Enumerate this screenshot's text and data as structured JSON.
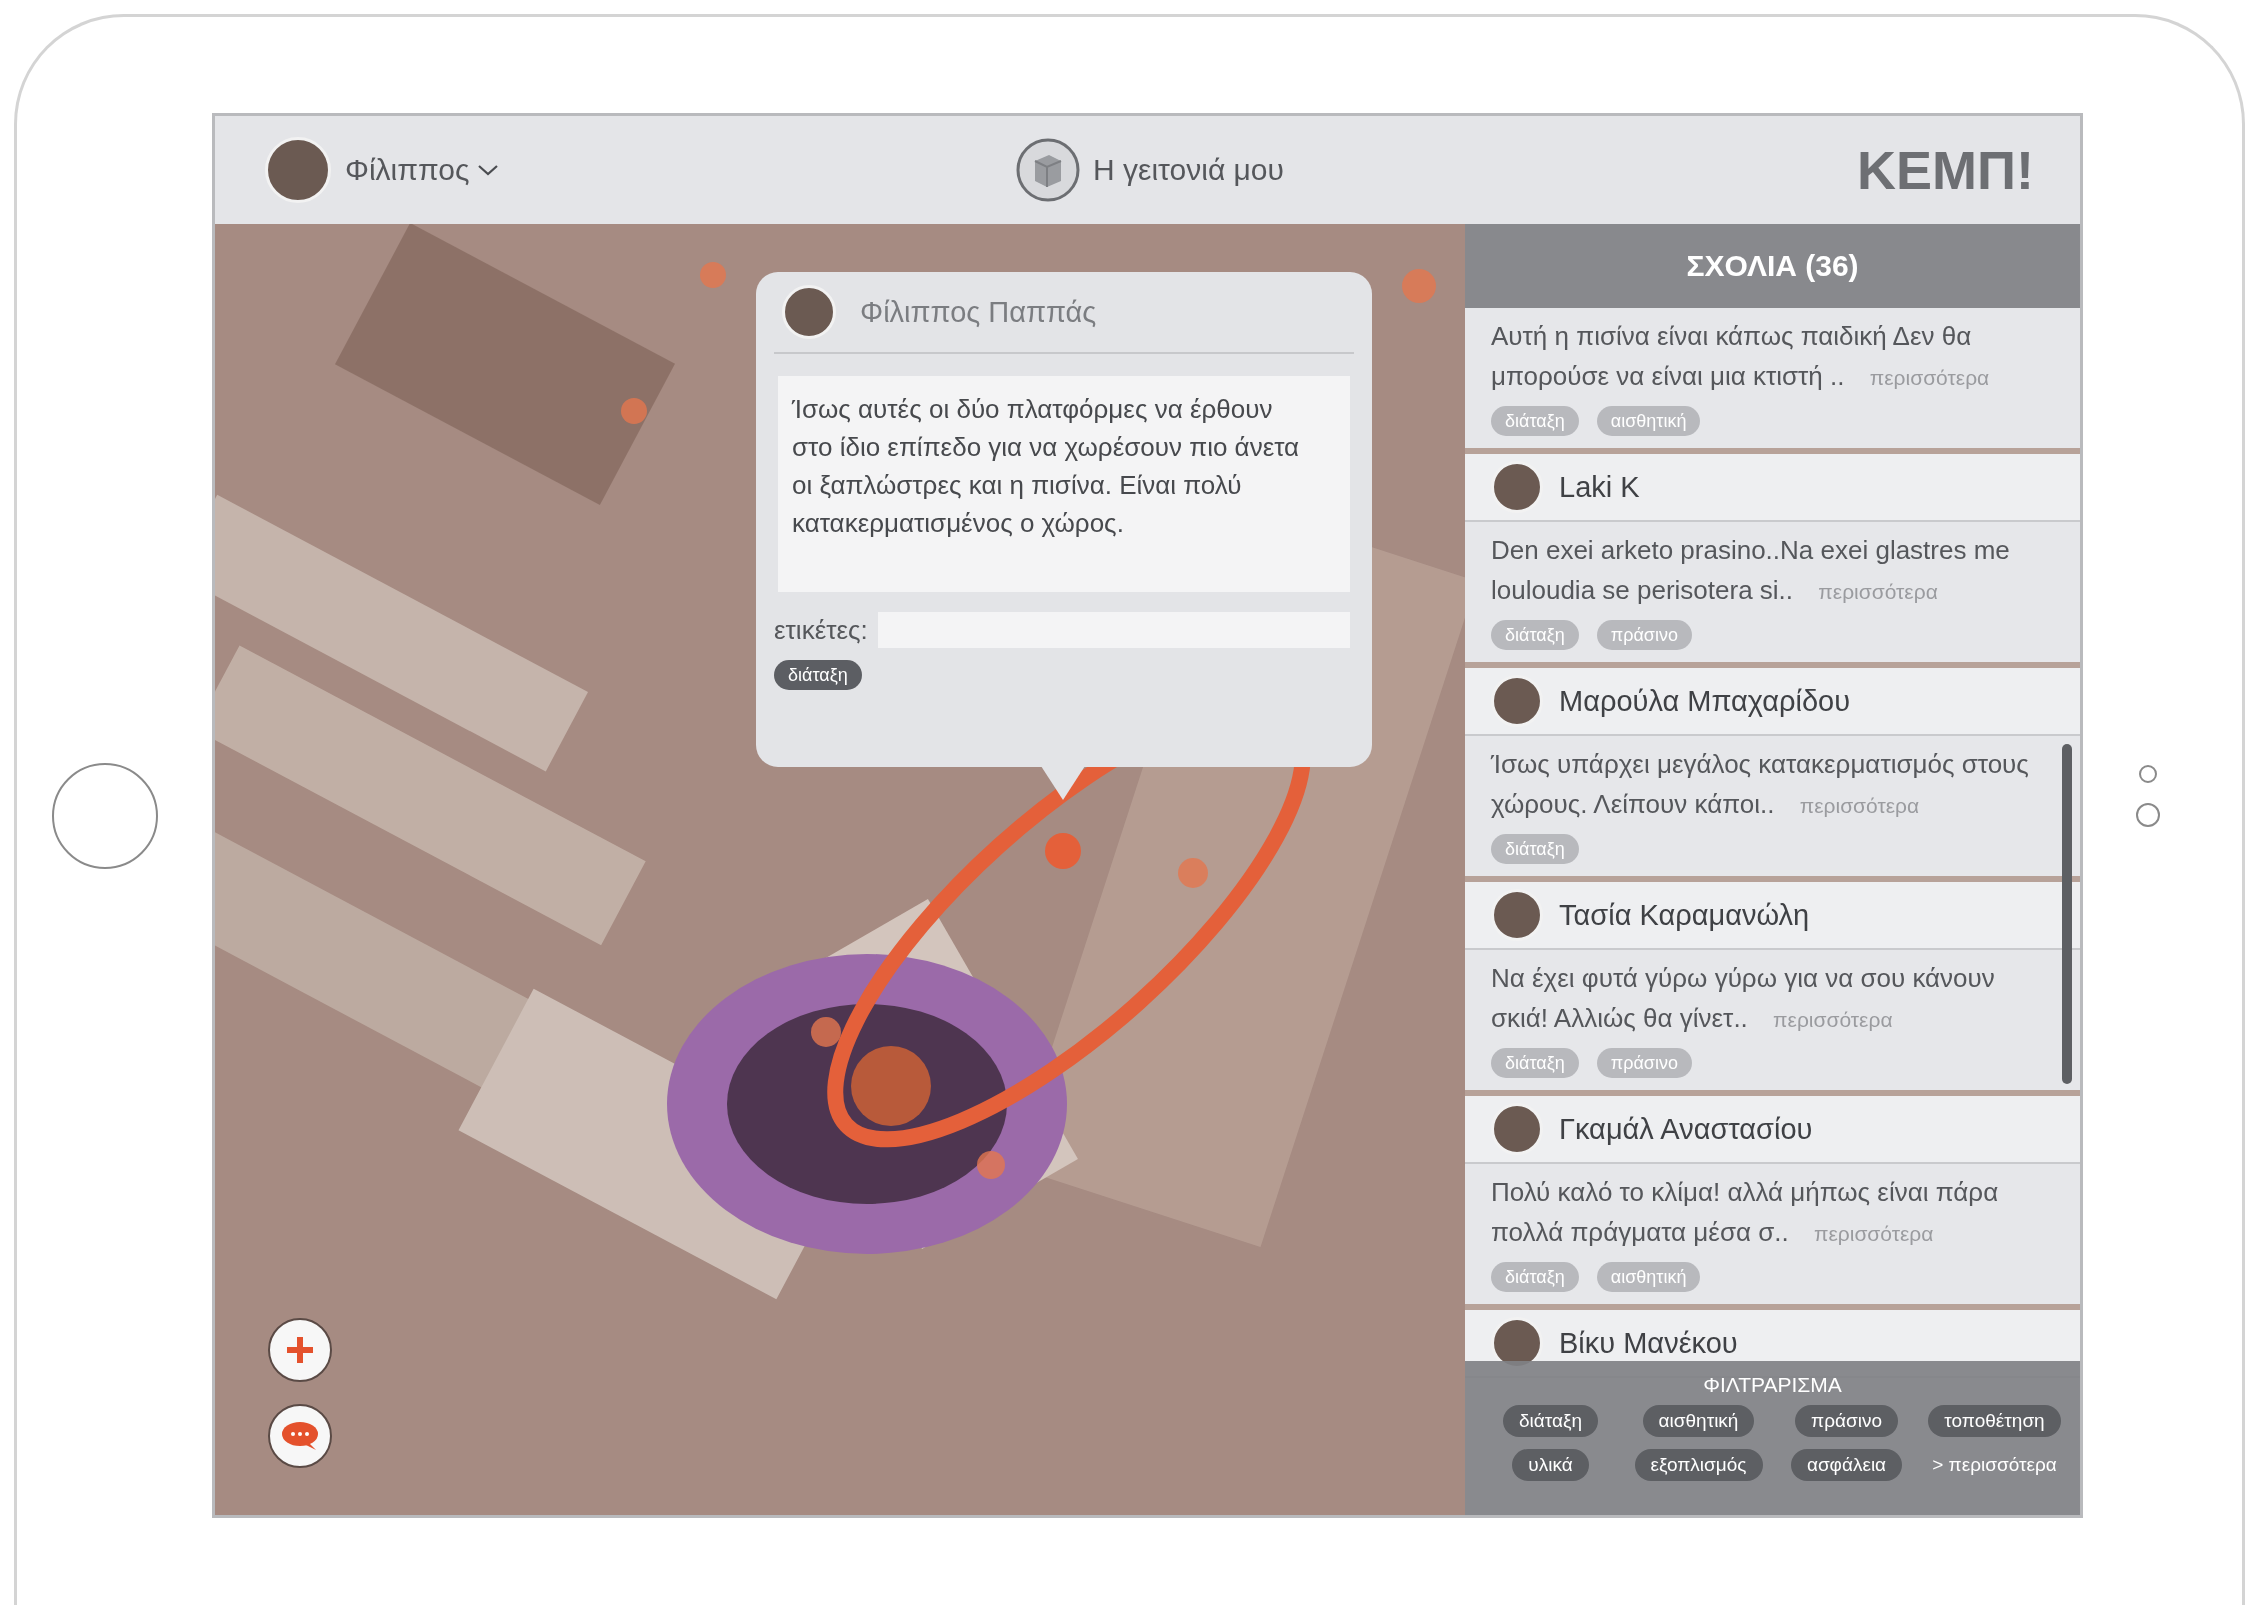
{
  "header": {
    "user_name": "Φίλιππος",
    "location": "Η γειτονιά μου",
    "logo": "ΚΕΜΠ!"
  },
  "popup": {
    "author": "Φίλιππος Παππάς",
    "text": "Ίσως αυτές οι δύο πλατφόρμες να έρθουν στο ίδιο επίπεδο για να χωρέσουν πιο άνετα οι ξαπλώστρες και η πισίνα. Είναι πολύ κατακερματισμένος ο χώρος.",
    "tags_label": "ετικέτες:",
    "tags": [
      "διάταξη"
    ]
  },
  "floating_buttons": [
    {
      "kind": "add"
    },
    {
      "kind": "chat"
    }
  ],
  "comments_panel": {
    "title": "ΣΧΟΛΙΑ (36)",
    "comments": [
      {
        "text": "Αυτή η πισίνα είναι κάπως παιδική Δεν θα μπορούσε να είναι μια κτιστή ..",
        "more": "περισσότερα",
        "tags": [
          "διάταξη",
          "αισθητική"
        ]
      },
      {
        "author": "Laki K",
        "text": "Den exei arketo prasino..Na exei glastres me louloudia se perisotera si..",
        "more": "περισσότερα",
        "tags": [
          "διάταξη",
          "πράσινο"
        ]
      },
      {
        "author": "Μαρούλα Μπαχαρίδου",
        "text": "Ίσως υπάρχει μεγάλος κατακερματισμός στους χώρους. Λείπουν κάποι..",
        "more": "περισσότερα",
        "tags": [
          "διάταξη"
        ]
      },
      {
        "author": "Τασία Καραμανώλη",
        "text": "Να έχει φυτά γύρω γύρω για να σου κάνουν σκιά! Αλλιώς θα γίνετ..",
        "more": "περισσότερα",
        "tags": [
          "διάταξη",
          "πράσινο"
        ]
      },
      {
        "author": "Γκαμάλ Αναστασίου",
        "text": "Πολύ καλό το κλίμα! αλλά μήπως είναι πάρα πολλά πράγματα μέσα σ..",
        "more": "περισσότερα",
        "tags": [
          "διάταξη",
          "αισθητική"
        ]
      },
      {
        "author": "Βίκυ Μανέκου"
      }
    ]
  },
  "filter": {
    "title": "ΦΙΛΤΡΑΡΙΣΜΑ",
    "tags": [
      "διάταξη",
      "αισθητική",
      "πράσινο",
      "τοποθέτηση",
      "υλικά",
      "εξοπλισμός",
      "ασφάλεια"
    ],
    "more": "> περισσότερα"
  }
}
